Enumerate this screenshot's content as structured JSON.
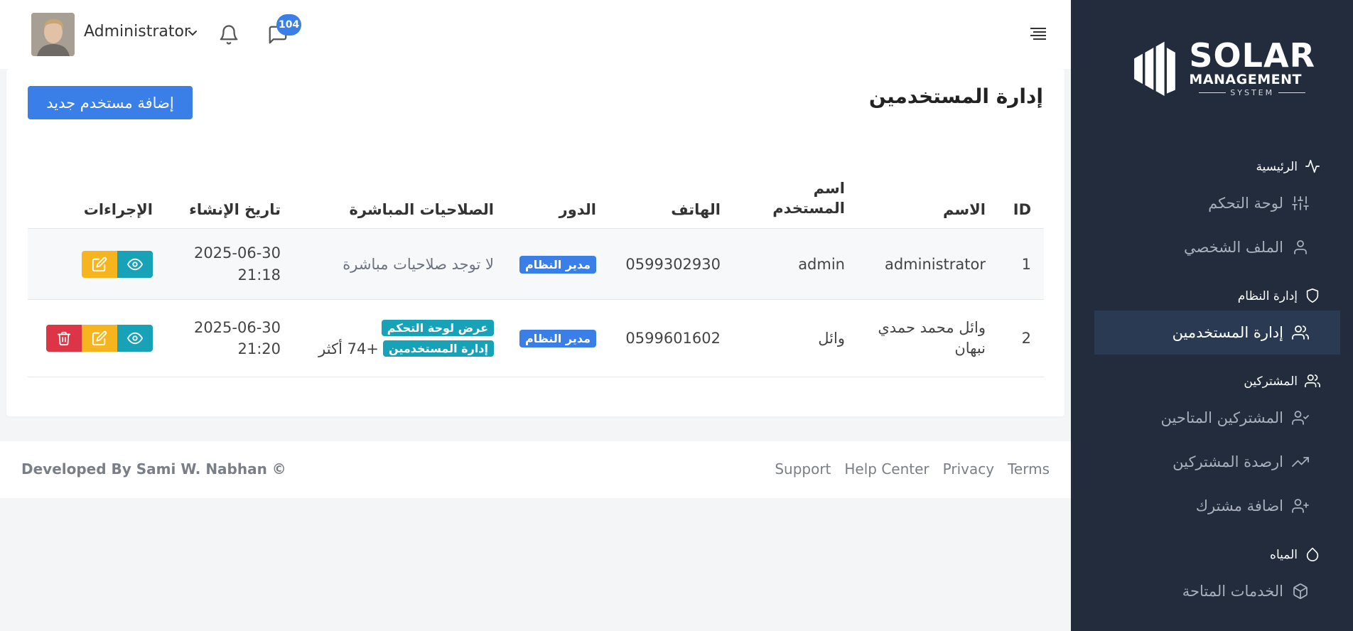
{
  "sidebar": {
    "logo": {
      "line1": "SOLAR",
      "line2": "MANAGEMENT",
      "line3": "SYSTEM"
    },
    "sections": [
      {
        "label": "الرئيسية",
        "icon": "activity-icon"
      },
      {
        "label": "إدارة النظام",
        "icon": "shield-icon"
      },
      {
        "label": "المشتركين",
        "icon": "users-icon"
      },
      {
        "label": "المياه",
        "icon": "droplet-icon"
      }
    ],
    "items": [
      {
        "label": "لوحة التحكم",
        "icon": "sliders-icon"
      },
      {
        "label": "الملف الشخصي",
        "icon": "user-icon"
      },
      {
        "label": "إدارة المستخدمين",
        "icon": "users-icon",
        "active": true
      },
      {
        "label": "المشتركين المتاحين",
        "icon": "user-check-icon"
      },
      {
        "label": "ارصدة المشتركين",
        "icon": "trending-up-icon"
      },
      {
        "label": "اضافة مشترك",
        "icon": "user-plus-icon"
      },
      {
        "label": "الخدمات المتاحة",
        "icon": "box-icon"
      }
    ]
  },
  "header": {
    "user_name": "Administrator",
    "messages_count": "104"
  },
  "main": {
    "title": "إدارة المستخدمين",
    "add_button": "إضافة مستخدم جديد",
    "columns": [
      "ID",
      "الاسم",
      "اسم المستخدم",
      "الهاتف",
      "الدور",
      "الصلاحيات المباشرة",
      "تاريخ الإنشاء",
      "الإجراءات"
    ],
    "rows": [
      {
        "id": "1",
        "name": "administrator",
        "username": "admin",
        "phone": "0599302930",
        "role": "مدير النظام",
        "permissions_none": "لا توجد صلاحيات مباشرة",
        "date": "2025-06-30",
        "time": "21:18"
      },
      {
        "id": "2",
        "name": "وائل محمد حمدي نبهان",
        "username": "وائل",
        "phone": "0599601602",
        "role": "مدير النظام",
        "perm1": "عرض لوحة التحكم",
        "perm2": "إدارة المستخدمين",
        "perm_more": "+74 أكثر",
        "date": "2025-06-30",
        "time": "21:20"
      }
    ]
  },
  "footer": {
    "credit": "Developed By Sami W. Nabhan ©",
    "links": [
      "Support",
      "Help Center",
      "Privacy",
      "Terms"
    ]
  },
  "colors": {
    "primary": "#3a7ee8",
    "info": "#17a2b8",
    "warning": "#f6b51e",
    "danger": "#dc3545",
    "sidebar": "#222c3c"
  }
}
